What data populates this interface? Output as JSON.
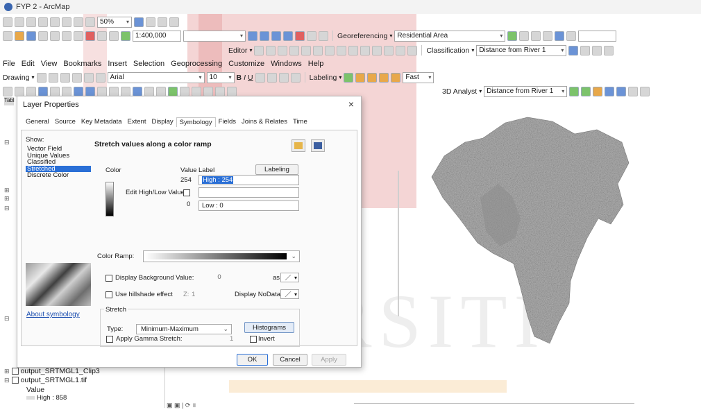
{
  "window": {
    "title": "FYP 2 - ArcMap"
  },
  "toolbars": {
    "standard": {
      "zoom_percent": "50%",
      "scale": "1:400,000"
    },
    "georef": {
      "label": "Georeferencing",
      "layer": "Residential Area",
      "classification": "Classification",
      "layer2": "Distance from River 1",
      "editor": "Editor"
    },
    "drawing": {
      "label": "Drawing",
      "font": "Arial",
      "font_size": "10",
      "bold": "B",
      "italic": "I",
      "underline": "U",
      "labeling": "Labeling",
      "quality": "Fast"
    },
    "analyst": {
      "label": "3D Analyst",
      "layer": "Distance from River 1"
    }
  },
  "menu": [
    "File",
    "Edit",
    "View",
    "Bookmarks",
    "Insert",
    "Selection",
    "Geoprocessing",
    "Customize",
    "Windows",
    "Help"
  ],
  "toc": {
    "tab_label": "Tabl",
    "layers": [
      {
        "name": "output_SRTMGL1_Clip3"
      },
      {
        "name": "output_SRTMGL1.tif"
      }
    ],
    "value_label": "Value",
    "high_label": "High : 858"
  },
  "dialog": {
    "title": "Layer Properties",
    "close": "×",
    "tabs": [
      "General",
      "Source",
      "Key Metadata",
      "Extent",
      "Display",
      "Symbology",
      "Fields",
      "Joins & Relates",
      "Time"
    ],
    "active_tab": "Symbology",
    "show_label": "Show:",
    "show_items": [
      "Vector Field",
      "Unique Values",
      "Classified",
      "Stretched",
      "Discrete Color"
    ],
    "selected_show": "Stretched",
    "about_link": "About symbology",
    "panel_title": "Stretch values along a color ramp",
    "color_header": "Color",
    "value_header": "Value",
    "label_header": "Label",
    "labeling_button": "Labeling",
    "high_value": "254",
    "high_label": "High : 254",
    "edit_high_low": "Edit High/Low Values",
    "low_value": "0",
    "low_label": "Low : 0",
    "color_ramp_label": "Color Ramp:",
    "display_background": "Display Background Value:",
    "background_value": "0",
    "as_label": "as",
    "use_hillshade": "Use hillshade effect",
    "z_label": "Z:",
    "z_value": "1",
    "display_nodata": "Display NoData as",
    "stretch_label": "Stretch",
    "type_label": "Type:",
    "type_value": "Minimum-Maximum",
    "histograms_button": "Histograms",
    "invert_label": "Invert",
    "gamma_label": "Apply Gamma Stretch:",
    "gamma_value": "1",
    "ok": "OK",
    "cancel": "Cancel",
    "apply": "Apply"
  },
  "watermark": {
    "text": "UNIVERSITI"
  }
}
